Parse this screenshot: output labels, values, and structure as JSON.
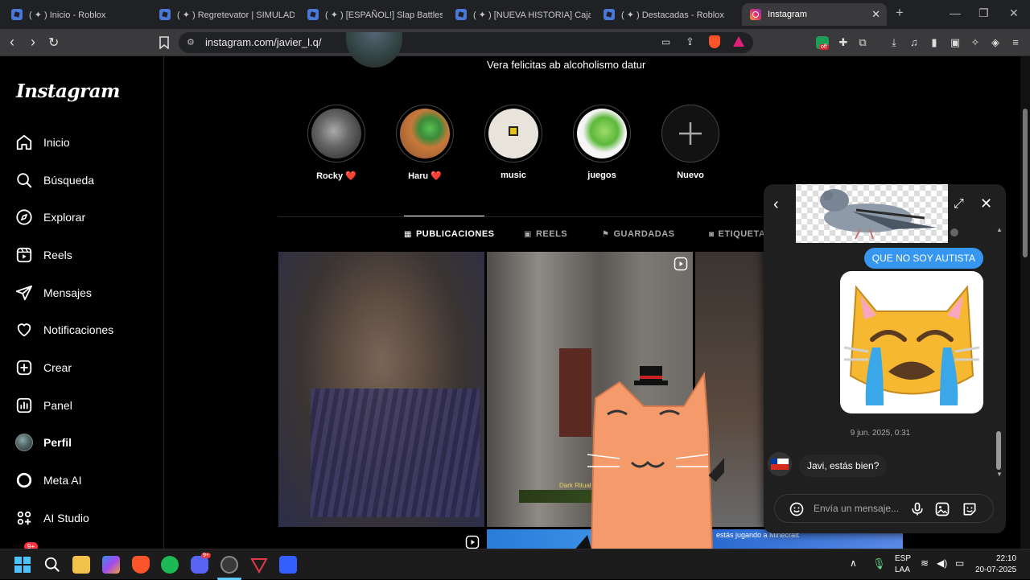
{
  "browser": {
    "tabs": [
      {
        "title": "( ✦ ) Inicio - Roblox"
      },
      {
        "title": "( ✦ ) Regretevator | SIMULADOR"
      },
      {
        "title": "( ✦ ) [ESPAÑOL!] Slap Battles"
      },
      {
        "title": "( ✦ ) [NUEVA HISTORIA] Caja de"
      },
      {
        "title": "( ✦ ) Destacadas - Roblox"
      },
      {
        "title": "Instagram"
      }
    ],
    "url": "instagram.com/javier_l.q/",
    "extension_badge": "off"
  },
  "sidebar": {
    "logo": "Instagram",
    "items": [
      {
        "label": "Inicio",
        "icon": "home-icon"
      },
      {
        "label": "Búsqueda",
        "icon": "search-icon"
      },
      {
        "label": "Explorar",
        "icon": "compass-icon"
      },
      {
        "label": "Reels",
        "icon": "reels-icon"
      },
      {
        "label": "Mensajes",
        "icon": "send-icon"
      },
      {
        "label": "Notificaciones",
        "icon": "heart-icon"
      },
      {
        "label": "Crear",
        "icon": "plus-square-icon"
      },
      {
        "label": "Panel",
        "icon": "chart-icon"
      },
      {
        "label": "Perfil",
        "icon": "avatar-icon"
      },
      {
        "label": "Meta AI",
        "icon": "ring-icon"
      },
      {
        "label": "AI Studio",
        "icon": "studio-icon"
      }
    ],
    "more_badge": "9+"
  },
  "profile": {
    "bio": "Vera felicitas ab alcoholismo datur",
    "highlights": [
      {
        "label": "Rocky ❤️"
      },
      {
        "label": "Haru ❤️"
      },
      {
        "label": "music"
      },
      {
        "label": "juegos"
      },
      {
        "label": "Nuevo"
      }
    ],
    "tabs": [
      {
        "label": "PUBLICACIONES"
      },
      {
        "label": "REELS"
      },
      {
        "label": "GUARDADAS"
      },
      {
        "label": "ETIQUETAS"
      }
    ],
    "post_overlay_text": "Dark Ritual",
    "banner_text": "estás jugando a Minecraft"
  },
  "chat": {
    "messages": [
      {
        "text": "QUE NO SOY AUTISTA",
        "from": "me"
      },
      {
        "text": "Javi, estás bien?",
        "from": "them"
      }
    ],
    "timestamp": "9 jun. 2025, 0:31",
    "input_placeholder": "Envía un mensaje...",
    "accent": "#3797f0"
  },
  "taskbar": {
    "discord_badge": "9+",
    "lang": "ESP",
    "layout": "LAA",
    "time": "22:10",
    "date": "20-07-2025"
  }
}
